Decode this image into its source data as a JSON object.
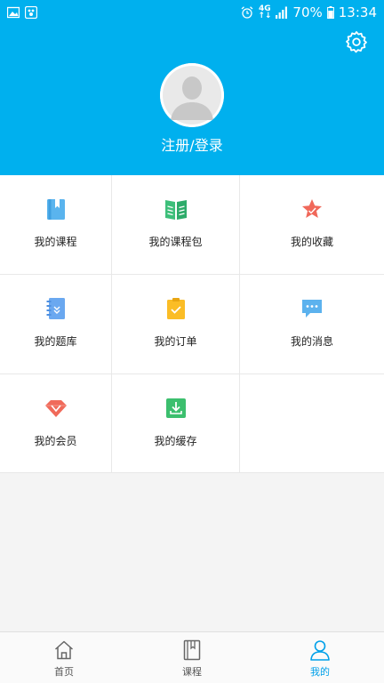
{
  "status_bar": {
    "network_top": "4G",
    "network_bottom": "↑↓",
    "battery": "70%",
    "time": "13:34"
  },
  "profile": {
    "login_label": "注册/登录"
  },
  "menu": {
    "items": [
      {
        "label": "我的课程",
        "icon": "course-book-icon"
      },
      {
        "label": "我的课程包",
        "icon": "course-package-icon"
      },
      {
        "label": "我的收藏",
        "icon": "star-icon"
      },
      {
        "label": "我的题库",
        "icon": "question-bank-icon"
      },
      {
        "label": "我的订单",
        "icon": "order-clipboard-icon"
      },
      {
        "label": "我的消息",
        "icon": "message-icon"
      },
      {
        "label": "我的会员",
        "icon": "diamond-icon"
      },
      {
        "label": "我的缓存",
        "icon": "download-icon"
      }
    ]
  },
  "bottom_nav": {
    "home": "首页",
    "courses": "课程",
    "mine": "我的"
  },
  "colors": {
    "primary": "#00b0ee",
    "active_tab": "#00a0e9"
  }
}
